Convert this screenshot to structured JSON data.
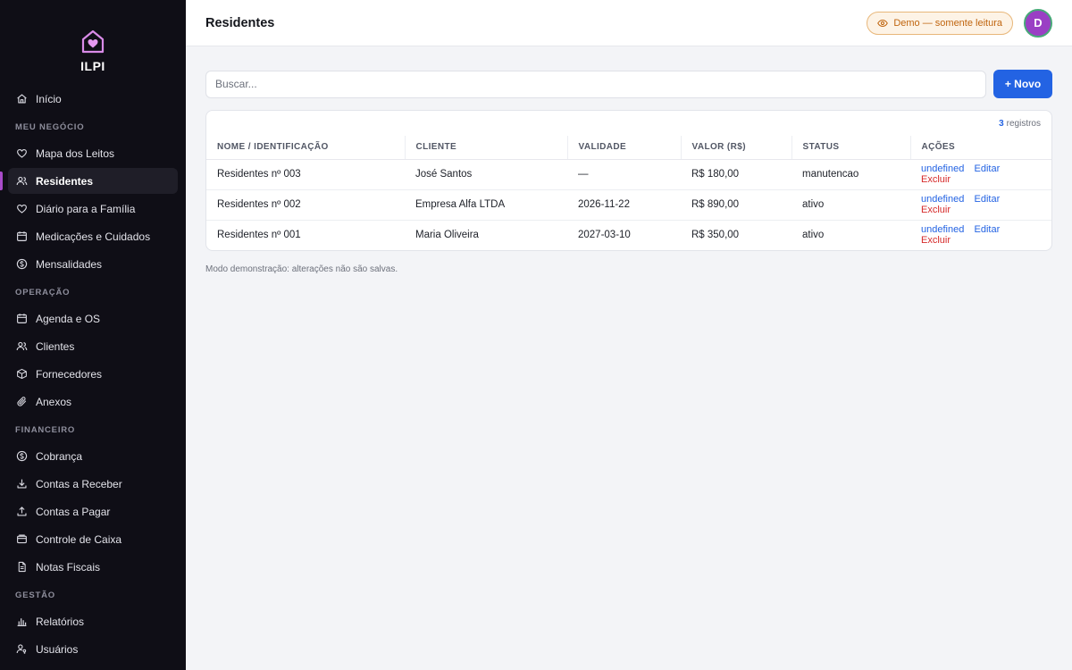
{
  "brand": {
    "name": "ILPI"
  },
  "sidebar": {
    "home": {
      "label": "Início",
      "icon": "home-icon"
    },
    "sections": [
      {
        "title": "MEU NEGÓCIO",
        "items": [
          {
            "label": "Mapa dos Leitos",
            "icon": "heart-icon"
          },
          {
            "label": "Residentes",
            "icon": "users-icon",
            "active": true
          },
          {
            "label": "Diário para a Família",
            "icon": "heart-icon"
          },
          {
            "label": "Medicações e Cuidados",
            "icon": "calendar-icon"
          },
          {
            "label": "Mensalidades",
            "icon": "dollar-circle-icon"
          }
        ]
      },
      {
        "title": "OPERAÇÃO",
        "items": [
          {
            "label": "Agenda e OS",
            "icon": "calendar-icon"
          },
          {
            "label": "Clientes",
            "icon": "users-icon"
          },
          {
            "label": "Fornecedores",
            "icon": "box-icon"
          },
          {
            "label": "Anexos",
            "icon": "paperclip-icon"
          }
        ]
      },
      {
        "title": "FINANCEIRO",
        "items": [
          {
            "label": "Cobrança",
            "icon": "dollar-circle-icon"
          },
          {
            "label": "Contas a Receber",
            "icon": "download-icon"
          },
          {
            "label": "Contas a Pagar",
            "icon": "upload-icon"
          },
          {
            "label": "Controle de Caixa",
            "icon": "wallet-icon"
          },
          {
            "label": "Notas Fiscais",
            "icon": "document-icon"
          }
        ]
      },
      {
        "title": "GESTÃO",
        "items": [
          {
            "label": "Relatórios",
            "icon": "bar-chart-icon"
          },
          {
            "label": "Usuários",
            "icon": "user-key-icon"
          }
        ]
      }
    ]
  },
  "header": {
    "title": "Residentes",
    "demo_badge": "Demo — somente leitura",
    "avatar_initial": "D"
  },
  "toolbar": {
    "search_placeholder": "Buscar...",
    "new_button": "+ Novo"
  },
  "table": {
    "count": "3",
    "count_suffix": "registros",
    "columns": [
      "NOME / IDENTIFICAÇÃO",
      "CLIENTE",
      "VALIDADE",
      "VALOR (R$)",
      "STATUS",
      "AÇÕES"
    ],
    "rows": [
      {
        "name": "Residentes nº 003",
        "client": "José Santos",
        "validity": "—",
        "value": "R$ 180,00",
        "status": "manutencao"
      },
      {
        "name": "Residentes nº 002",
        "client": "Empresa Alfa LTDA",
        "validity": "2026-11-22",
        "value": "R$ 890,00",
        "status": "ativo"
      },
      {
        "name": "Residentes nº 001",
        "client": "Maria Oliveira",
        "validity": "2027-03-10",
        "value": "R$ 350,00",
        "status": "ativo"
      }
    ],
    "actions": {
      "first": "undefined",
      "edit": "Editar",
      "delete": "Excluir"
    }
  },
  "footnote": "Modo demonstração: alterações não são salvas.",
  "colors": {
    "accent": "#2363e3",
    "danger": "#d62a2a",
    "sidebar_bg": "#0f0e16",
    "brand": "#a84bc9",
    "demo": "#c0650f"
  }
}
